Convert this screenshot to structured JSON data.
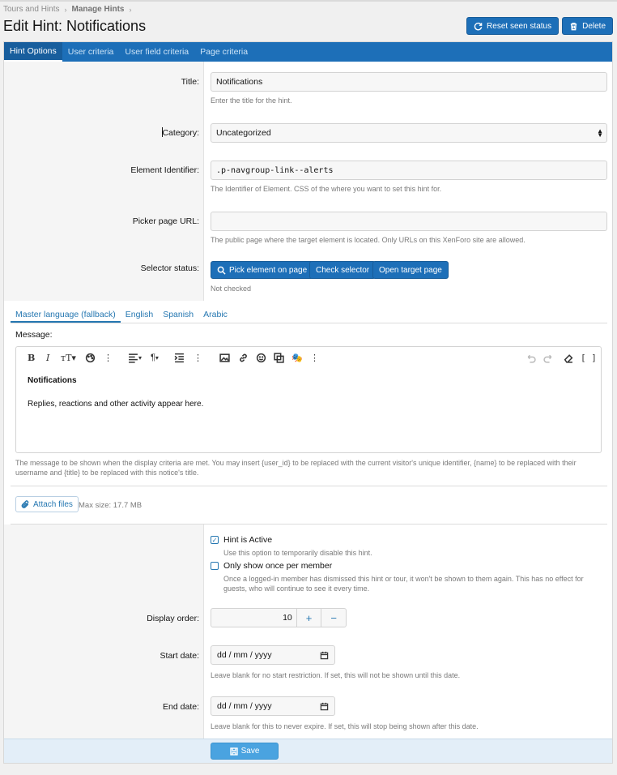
{
  "breadcrumb": {
    "items": [
      "Tours and Hints",
      "Manage Hints"
    ]
  },
  "page": {
    "title": "Edit Hint: Notifications"
  },
  "header": {
    "reset_label": "Reset seen status",
    "delete_label": "Delete"
  },
  "tabs": [
    {
      "label": "Hint Options"
    },
    {
      "label": "User criteria"
    },
    {
      "label": "User field criteria"
    },
    {
      "label": "Page criteria"
    }
  ],
  "form": {
    "title": {
      "label": "Title:",
      "value": "Notifications",
      "hint": "Enter the title for the hint."
    },
    "category": {
      "label": "Category:",
      "value": "Uncategorized"
    },
    "element": {
      "label": "Element Identifier:",
      "value": ".p-navgroup-link--alerts",
      "hint": "The Identifier of Element. CSS of the where you want to set this hint for."
    },
    "picker": {
      "label": "Picker page URL:",
      "value": "",
      "hint": "The public page where the target element is located. Only URLs on this XenForo site are allowed."
    },
    "selector": {
      "label": "Selector status:",
      "pick_label": "Pick element on page",
      "check_label": "Check selector",
      "open_label": "Open target page",
      "status": "Not checked"
    }
  },
  "languages": [
    {
      "label": "Master language (fallback)"
    },
    {
      "label": "English"
    },
    {
      "label": "Spanish"
    },
    {
      "label": "Arabic"
    }
  ],
  "message": {
    "label": "Message:",
    "heading": "Notifications",
    "body": "Replies, reactions and other activity appear here.",
    "hint_line1": "The message to be shown when the display criteria are met. You may insert {user_id} to be replaced with the current visitor's unique identifier, {name} to be replaced with their",
    "hint_line2": "username and {title} to be replaced with this notice's title."
  },
  "attach": {
    "label": "Attach files",
    "max_size": "Max size: 17.7 MB"
  },
  "options": {
    "active": {
      "label": "Hint is Active",
      "hint": "Use this option to temporarily disable this hint.",
      "checked": true
    },
    "once": {
      "label": "Only show once per member",
      "hint": "Once a logged-in member has dismissed this hint or tour, it won't be shown to them again. This has no effect for guests, who will continue to see it every time.",
      "checked": false
    }
  },
  "display_order": {
    "label": "Display order:",
    "value": "10",
    "plus": "+",
    "minus": "−"
  },
  "start_date": {
    "label": "Start date:",
    "value": "dd / mm / yyyy",
    "hint": "Leave blank for no start restriction. If set, this will not be shown until this date."
  },
  "end_date": {
    "label": "End date:",
    "value": "dd / mm / yyyy",
    "hint": "Leave blank for this to never expire. If set, this will stop being shown after this date."
  },
  "save_label": "Save",
  "colors": {
    "brand": "#1d6fb8",
    "link": "#2577b1",
    "save": "#4aa3e0"
  }
}
